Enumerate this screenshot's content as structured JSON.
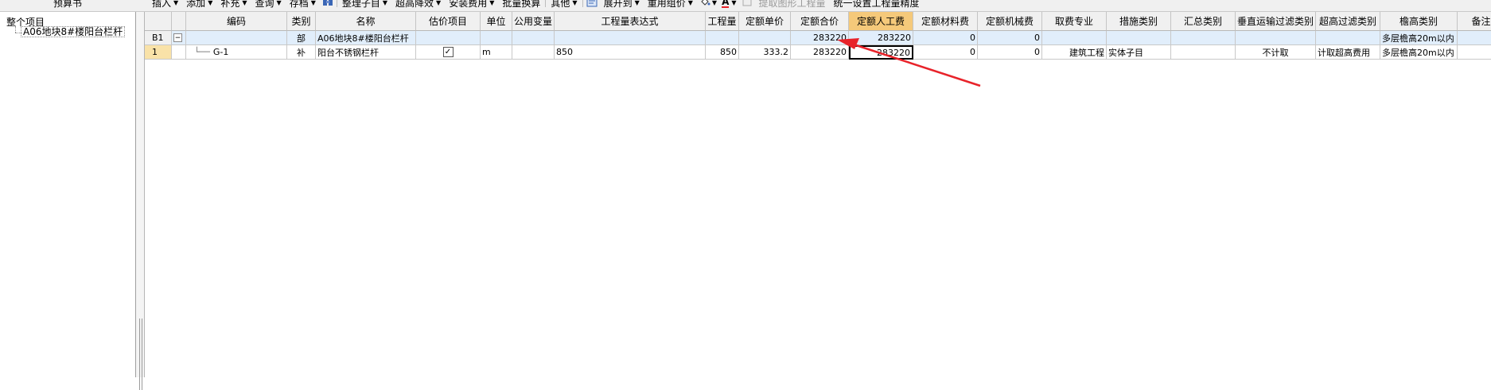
{
  "left_panel": {
    "title": "预算书",
    "tree_root": "整个项目",
    "tree_child": "A06地块8#楼阳台栏杆"
  },
  "toolbar": {
    "items": [
      {
        "label": "插入",
        "dropdown": true
      },
      {
        "label": "添加",
        "dropdown": true
      },
      {
        "label": "补充",
        "dropdown": true
      },
      {
        "label": "查询",
        "dropdown": true
      },
      {
        "label": "存档",
        "dropdown": true
      },
      {
        "label": "整理子目",
        "dropdown": true
      },
      {
        "label": "超高降效",
        "dropdown": true
      },
      {
        "label": "安装费用",
        "dropdown": true
      },
      {
        "label": "批量换算",
        "dropdown": false
      },
      {
        "label": "其他",
        "dropdown": true
      },
      {
        "label": "展开到",
        "dropdown": true
      },
      {
        "label": "重用组价",
        "dropdown": true
      },
      {
        "label": "提取图形工程量",
        "dropdown": false,
        "disabled": true
      },
      {
        "label": "统一设置工程量精度",
        "dropdown": false
      }
    ],
    "font_color_glyph": "A"
  },
  "grid": {
    "columns": [
      "",
      "",
      "编码",
      "类别",
      "名称",
      "估价项目",
      "单位",
      "公用变量",
      "工程量表达式",
      "工程量",
      "定额单价",
      "定额合价",
      "定额人工费",
      "定额材料费",
      "定额机械费",
      "取费专业",
      "措施类别",
      "汇总类别",
      "垂直运输过滤类别",
      "超高过滤类别",
      "檐高类别",
      "备注"
    ],
    "active_column": 12,
    "rows": [
      {
        "rownum": "B1",
        "expander": "−",
        "code": "",
        "type": "部",
        "name": "A06地块8#楼阳台栏杆",
        "estimate": false,
        "unit": "",
        "public_var": "",
        "expression": "",
        "quantity": "",
        "unit_price": "",
        "total": "283220",
        "labor": "283220",
        "material": "0",
        "machine": "0",
        "fee_major": "",
        "measure_type": "",
        "summary_type": "",
        "vertical_filter": "",
        "super_high_filter": "",
        "eave_type": "多层檐高20m以内",
        "remark": ""
      },
      {
        "rownum": "1",
        "expander": "",
        "code": "G-1",
        "type": "补",
        "name": "阳台不锈钢栏杆",
        "estimate": true,
        "unit": "m",
        "public_var": "",
        "expression": "850",
        "quantity": "850",
        "unit_price": "333.2",
        "total": "283220",
        "labor": "283220",
        "material": "0",
        "machine": "0",
        "fee_major": "建筑工程",
        "measure_type": "实体子目",
        "summary_type": "",
        "vertical_filter": "不计取",
        "super_high_filter": "计取超高费用",
        "eave_type": "多层檐高20m以内",
        "remark": ""
      }
    ]
  },
  "colors": {
    "header_bg": "#f0f0f0",
    "active_header": "#f5c97a",
    "group_row_bg": "#e1eefb",
    "arrow": "#e8232a"
  }
}
